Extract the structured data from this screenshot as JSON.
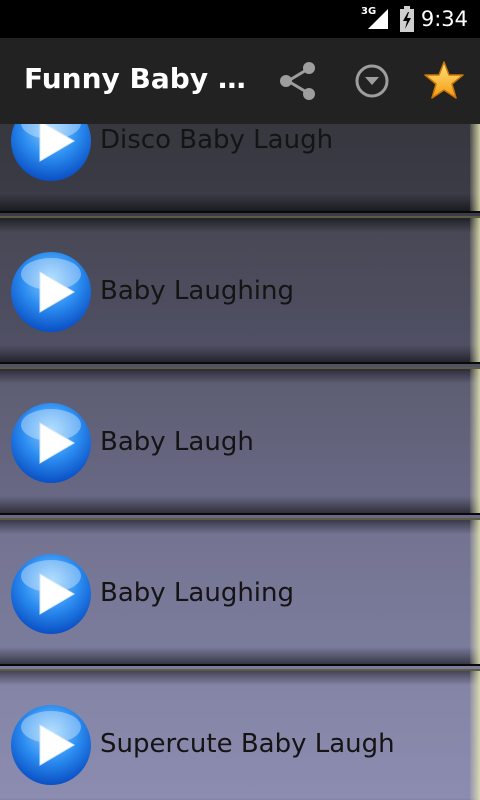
{
  "status_bar": {
    "network": "3G",
    "time": "9:34"
  },
  "action_bar": {
    "title": "Funny Baby Laugh",
    "actions": [
      {
        "name": "share",
        "icon": "share-icon"
      },
      {
        "name": "overflow",
        "icon": "dropdown-circle-icon"
      },
      {
        "name": "favorite",
        "icon": "star-icon",
        "color": "#f7b51c"
      }
    ]
  },
  "list": {
    "items": [
      {
        "label": "Disco Baby Laugh",
        "icon": "play-icon"
      },
      {
        "label": "Baby Laughing",
        "icon": "play-icon"
      },
      {
        "label": "Baby Laugh",
        "icon": "play-icon"
      },
      {
        "label": "Baby Laughing",
        "icon": "play-icon"
      },
      {
        "label": "Supercute Baby Laugh",
        "icon": "play-icon"
      }
    ]
  },
  "colors": {
    "action_bar_bg": "#222222",
    "status_bar_bg": "#000000",
    "play_icon_blue": "#1e6fe0",
    "star_gold": "#f7b51c"
  }
}
